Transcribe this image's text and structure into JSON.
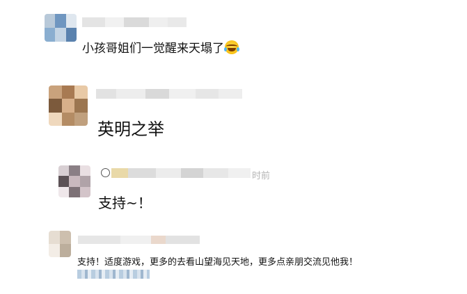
{
  "comments": [
    {
      "text": "小孩哥姐们一觉醒来天塌了",
      "emoji": "grinning-tears-emoji",
      "avatar_colors": [
        "#b8c9d9",
        "#6f96c0",
        "#dfe7ef",
        "#8aaed0",
        "#c3d4e4",
        "#5a82ae"
      ],
      "name_colors": [
        "#e4e4e4",
        "#f1f1f1",
        "#dadada",
        "#efefef",
        "#e9e9e9"
      ]
    },
    {
      "text": "英明之举",
      "avatar_colors": [
        "#c9a27c",
        "#a87a52",
        "#e8c9a6",
        "#7c5a3c",
        "#d8b08a",
        "#9c7650",
        "#efd8bd",
        "#b48c64",
        "#c0a07e"
      ],
      "name_colors": [
        "#e2e2e2",
        "#ededed",
        "#d9d9d9",
        "#f0f0f0",
        "#e6e6e6",
        "#eeeeee"
      ]
    },
    {
      "text": "支持~！",
      "time": "时前",
      "avatar_colors": [
        "#d8cfd3",
        "#8a7f85",
        "#e9dfe2",
        "#5c5256",
        "#c9b9be",
        "#b0a3a8",
        "#efe7ea",
        "#7d7176",
        "#d3c4c9"
      ],
      "name_colors": [
        "#e9d9a8",
        "#dcdcdc",
        "#ececec",
        "#d4d4d4",
        "#e7e7e7",
        "#f0f0f0"
      ]
    },
    {
      "text": "支持！适度游戏，更多的去看山望海见天地，更多点亲朋交流见他我！",
      "avatar_colors": [
        "#e6ddd2",
        "#cdbfae",
        "#f3ede6",
        "#bcae9c"
      ],
      "name_colors": [
        "#e6e6e6",
        "#f0f0f0",
        "#ead8cc",
        "#e2e2e2"
      ]
    }
  ]
}
